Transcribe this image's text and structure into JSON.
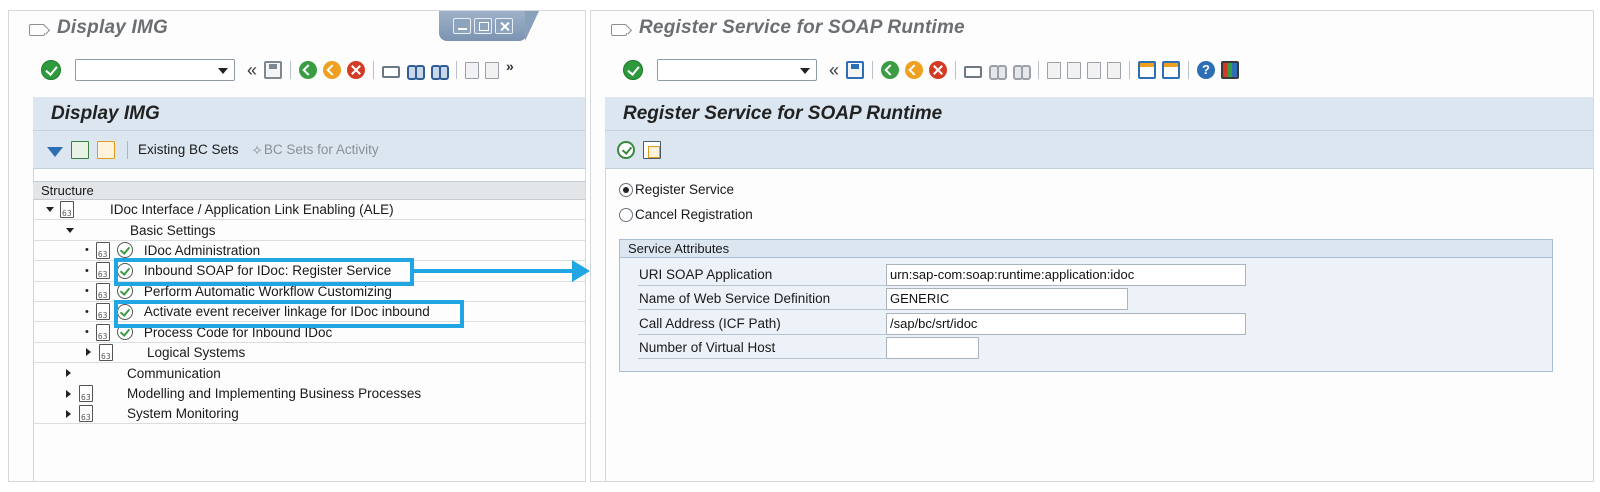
{
  "left_window": {
    "title": "Display IMG",
    "toolbar": {
      "prev_glyph": "«",
      "more_glyph": "»"
    },
    "page_header": "Display IMG",
    "app_toolbar": {
      "existing_bc_sets": "Existing BC Sets",
      "bc_sets_for_activity": "BC Sets for Activity"
    },
    "structure_header": "Structure",
    "tree": [
      {
        "label": "IDoc Interface / Application Link Enabling (ALE)"
      },
      {
        "label": "Basic Settings"
      },
      {
        "label": "IDoc Administration"
      },
      {
        "label": "Inbound SOAP for IDoc: Register Service"
      },
      {
        "label": "Perform Automatic Workflow Customizing"
      },
      {
        "label": "Activate event receiver linkage for IDoc inbound"
      },
      {
        "label": "Process Code for Inbound IDoc"
      },
      {
        "label": "Logical Systems"
      },
      {
        "label": "Communication"
      },
      {
        "label": "Modelling and Implementing Business Processes"
      },
      {
        "label": "System Monitoring"
      }
    ]
  },
  "right_window": {
    "title": "Register Service for SOAP Runtime",
    "toolbar": {
      "prev_glyph": "«"
    },
    "page_header": "Register Service for SOAP Runtime",
    "radios": [
      {
        "label": "Register Service",
        "checked": true
      },
      {
        "label": "Cancel Registration",
        "checked": false
      }
    ],
    "group_title": "Service Attributes",
    "fields": [
      {
        "label": "URI SOAP Application",
        "value": "urn:sap-com:soap:runtime:application:idoc"
      },
      {
        "label": "Name of Web Service Definition",
        "value": "GENERIC"
      },
      {
        "label": "Call Address (ICF Path)",
        "value": "/sap/bc/srt/idoc"
      },
      {
        "label": "Number of Virtual Host",
        "value": ""
      }
    ]
  },
  "colors": {
    "highlight": "#1fa6e3",
    "header_bg": "#dbe6f1"
  }
}
